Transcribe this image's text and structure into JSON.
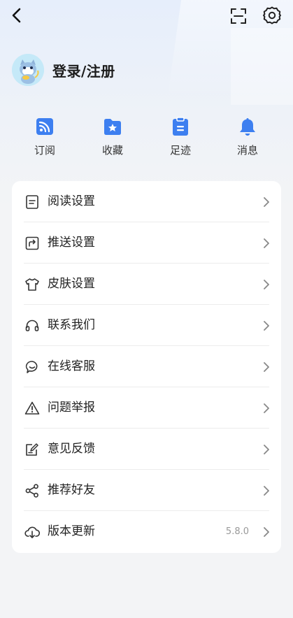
{
  "profile": {
    "login_label": "登录/注册"
  },
  "quick_actions": [
    {
      "label": "订阅",
      "icon": "rss-icon"
    },
    {
      "label": "收藏",
      "icon": "star-folder-icon"
    },
    {
      "label": "足迹",
      "icon": "clipboard-icon"
    },
    {
      "label": "消息",
      "icon": "bell-icon"
    }
  ],
  "menu": [
    {
      "label": "阅读设置",
      "icon": "document-icon"
    },
    {
      "label": "推送设置",
      "icon": "share-box-icon"
    },
    {
      "label": "皮肤设置",
      "icon": "shirt-icon"
    },
    {
      "label": "联系我们",
      "icon": "headset-icon"
    },
    {
      "label": "在线客服",
      "icon": "chat-bubble-icon"
    },
    {
      "label": "问题举报",
      "icon": "warning-icon"
    },
    {
      "label": "意见反馈",
      "icon": "edit-note-icon"
    },
    {
      "label": "推荐好友",
      "icon": "share-nodes-icon"
    },
    {
      "label": "版本更新",
      "icon": "cloud-download-icon",
      "value": "5.8.0"
    }
  ],
  "colors": {
    "accent": "#3d7ff0",
    "background": "#f3f4f6",
    "card": "#ffffff"
  }
}
